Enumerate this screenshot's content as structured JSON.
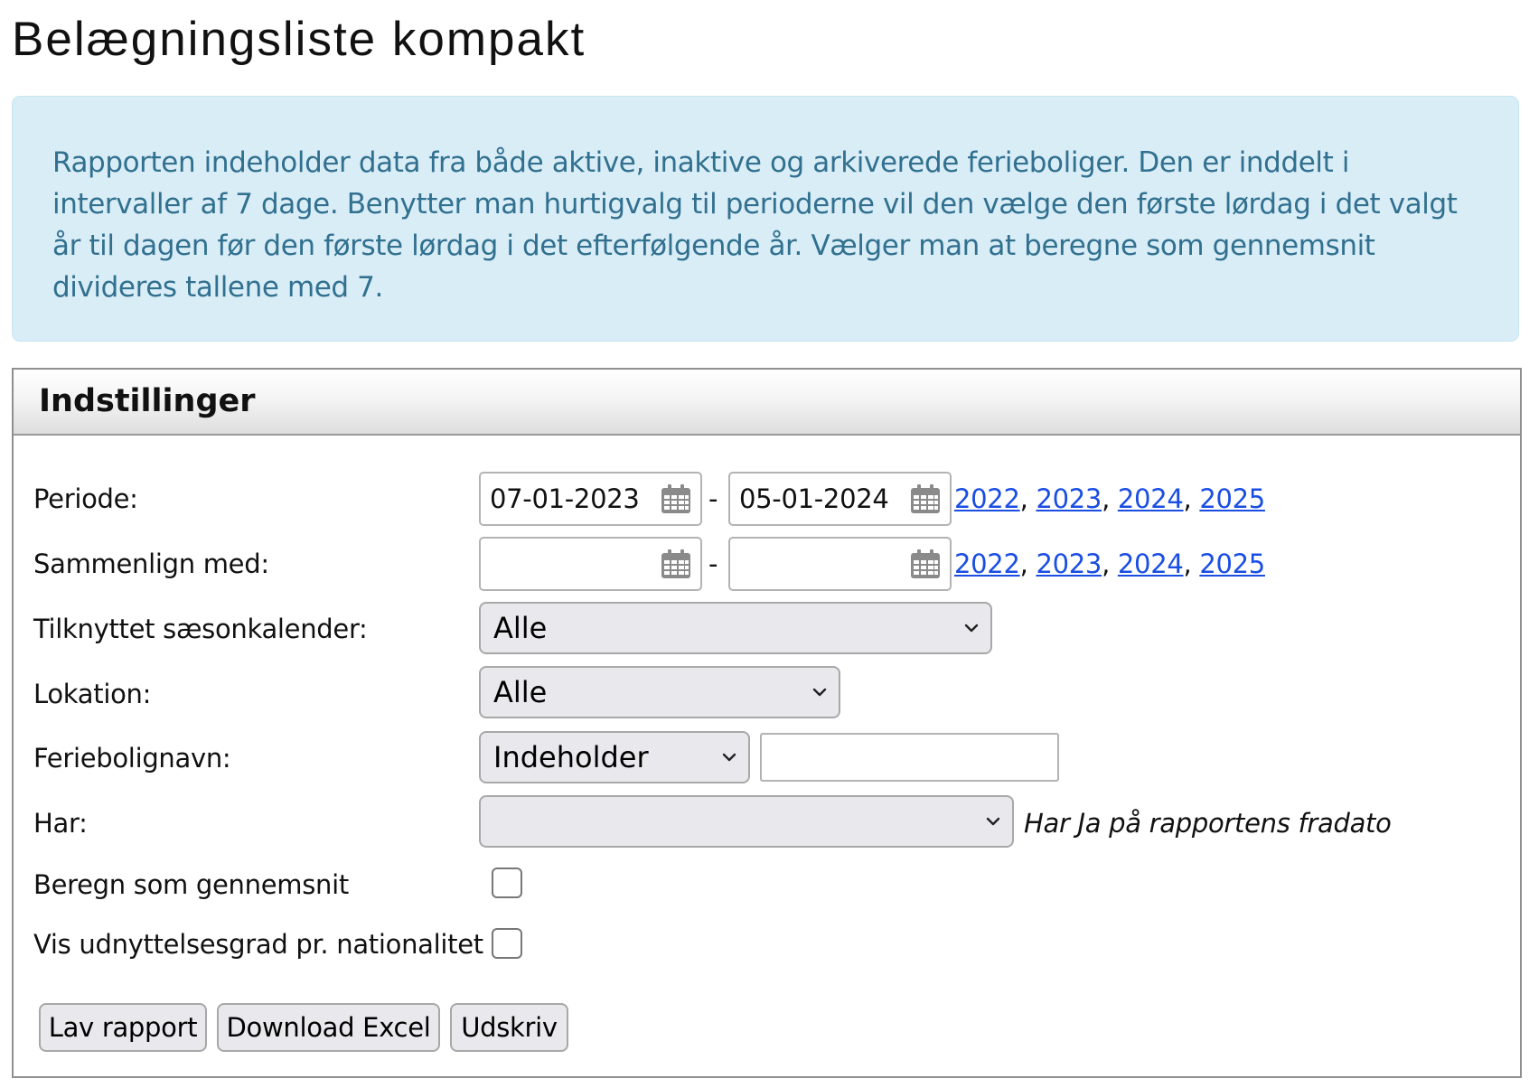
{
  "page": {
    "title": "Belægningsliste kompakt"
  },
  "info": {
    "text": "Rapporten indeholder data fra både aktive, inaktive og arkiverede ferieboliger. Den er inddelt i intervaller af 7 dage. Benytter man hurtigvalg til perioderne vil den vælge den første lørdag i det valgt år til dagen før den første lørdag i det efterfølgende år. Vælger man at beregne som gennemsnit divideres tallene med 7."
  },
  "settings": {
    "header": "Indstillinger",
    "periode": {
      "label": "Periode:",
      "from": "07-01-2023",
      "to": "05-01-2024",
      "dash": "-",
      "years": [
        "2022",
        "2023",
        "2024",
        "2025"
      ],
      "separator": ","
    },
    "sammenlign": {
      "label": "Sammenlign med:",
      "from": "",
      "to": "",
      "dash": "-",
      "years": [
        "2022",
        "2023",
        "2024",
        "2025"
      ],
      "separator": ","
    },
    "saesonkalender": {
      "label": "Tilknyttet sæsonkalender:",
      "selected": "Alle"
    },
    "lokation": {
      "label": "Lokation:",
      "selected": "Alle"
    },
    "feriebolignavn": {
      "label": "Feriebolignavn:",
      "mode_selected": "Indeholder",
      "value": ""
    },
    "har": {
      "label": "Har:",
      "selected": "",
      "hint": "Har Ja på rapportens fradato"
    },
    "gennemsnit": {
      "label": "Beregn som gennemsnit",
      "checked": false
    },
    "nationalitet": {
      "label": "Vis udnyttelsesgrad pr. nationalitet",
      "checked": false
    },
    "buttons": {
      "lav_rapport": "Lav rapport",
      "download_excel": "Download Excel",
      "udskriv": "Udskriv"
    }
  }
}
